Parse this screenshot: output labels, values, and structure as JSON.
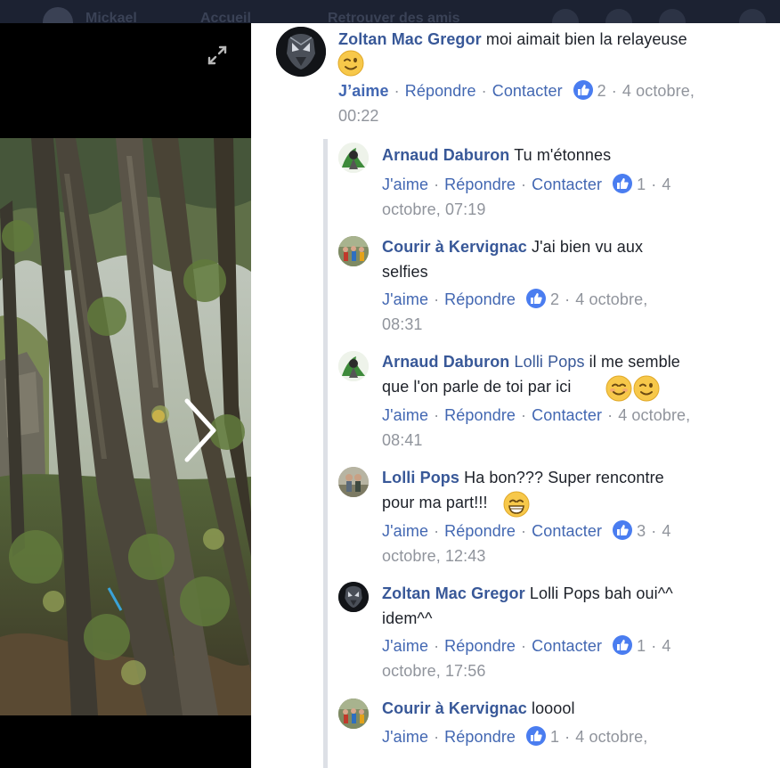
{
  "topbar": {
    "items": [
      "Mickael",
      "Accueil",
      "Retrouver des amis"
    ]
  },
  "viewer": {
    "expand_icon": "expand-icon",
    "next_icon": "chevron-right-icon"
  },
  "comments": [
    {
      "author": "Zoltan Mac Gregor",
      "text": "moi aimait bien la relayeuse",
      "emoji": [
        "wink"
      ],
      "like": "J’aime",
      "reply": "Répondre",
      "contact": "Contacter",
      "likes": "2",
      "date_line1": "4 octobre,",
      "date_line2": "00:22"
    },
    {
      "author": "Arnaud Daburon",
      "text": "Tu m'étonnes",
      "like": "J'aime",
      "reply": "Répondre",
      "contact": "Contacter",
      "likes": "1",
      "date_line1": "4",
      "date_line2": "octobre, 07:19"
    },
    {
      "author": "Courir à Kervignac",
      "text_line1": "J'ai bien vu aux",
      "text_line2": "selfies",
      "like": "J'aime",
      "reply": "Répondre",
      "likes": "2",
      "date_line1": "4 octobre,",
      "date_line2": "08:31"
    },
    {
      "author": "Arnaud Daburon",
      "mention": "Lolli Pops",
      "text_line1": "il me semble",
      "text_line2": "que l'on parle de toi par ici",
      "emoji": [
        "smile",
        "wink"
      ],
      "like": "J'aime",
      "reply": "Répondre",
      "contact": "Contacter",
      "date_line1": "4 octobre,",
      "date_line2": "08:41"
    },
    {
      "author": "Lolli Pops",
      "text_line1": "Ha bon??? Super rencontre",
      "text_line2": "pour ma part!!!",
      "emoji": [
        "grin"
      ],
      "like": "J'aime",
      "reply": "Répondre",
      "contact": "Contacter",
      "likes": "3",
      "date_line1": "4",
      "date_line2": "octobre, 12:43"
    },
    {
      "author": "Zoltan Mac Gregor",
      "text_line1": "Lolli Pops bah oui^^",
      "text_line2": "idem^^",
      "like": "J'aime",
      "reply": "Répondre",
      "contact": "Contacter",
      "likes": "1",
      "date_line1": "4",
      "date_line2": "octobre, 17:56"
    },
    {
      "author": "Courir à Kervignac",
      "text": "looool",
      "like": "J'aime",
      "reply": "Répondre",
      "likes": "1",
      "date_line1": "4 octobre,"
    }
  ],
  "colors": {
    "author": "#385898",
    "link": "#4267b2",
    "meta": "#90949c",
    "like_badge": "#4a7df0"
  }
}
